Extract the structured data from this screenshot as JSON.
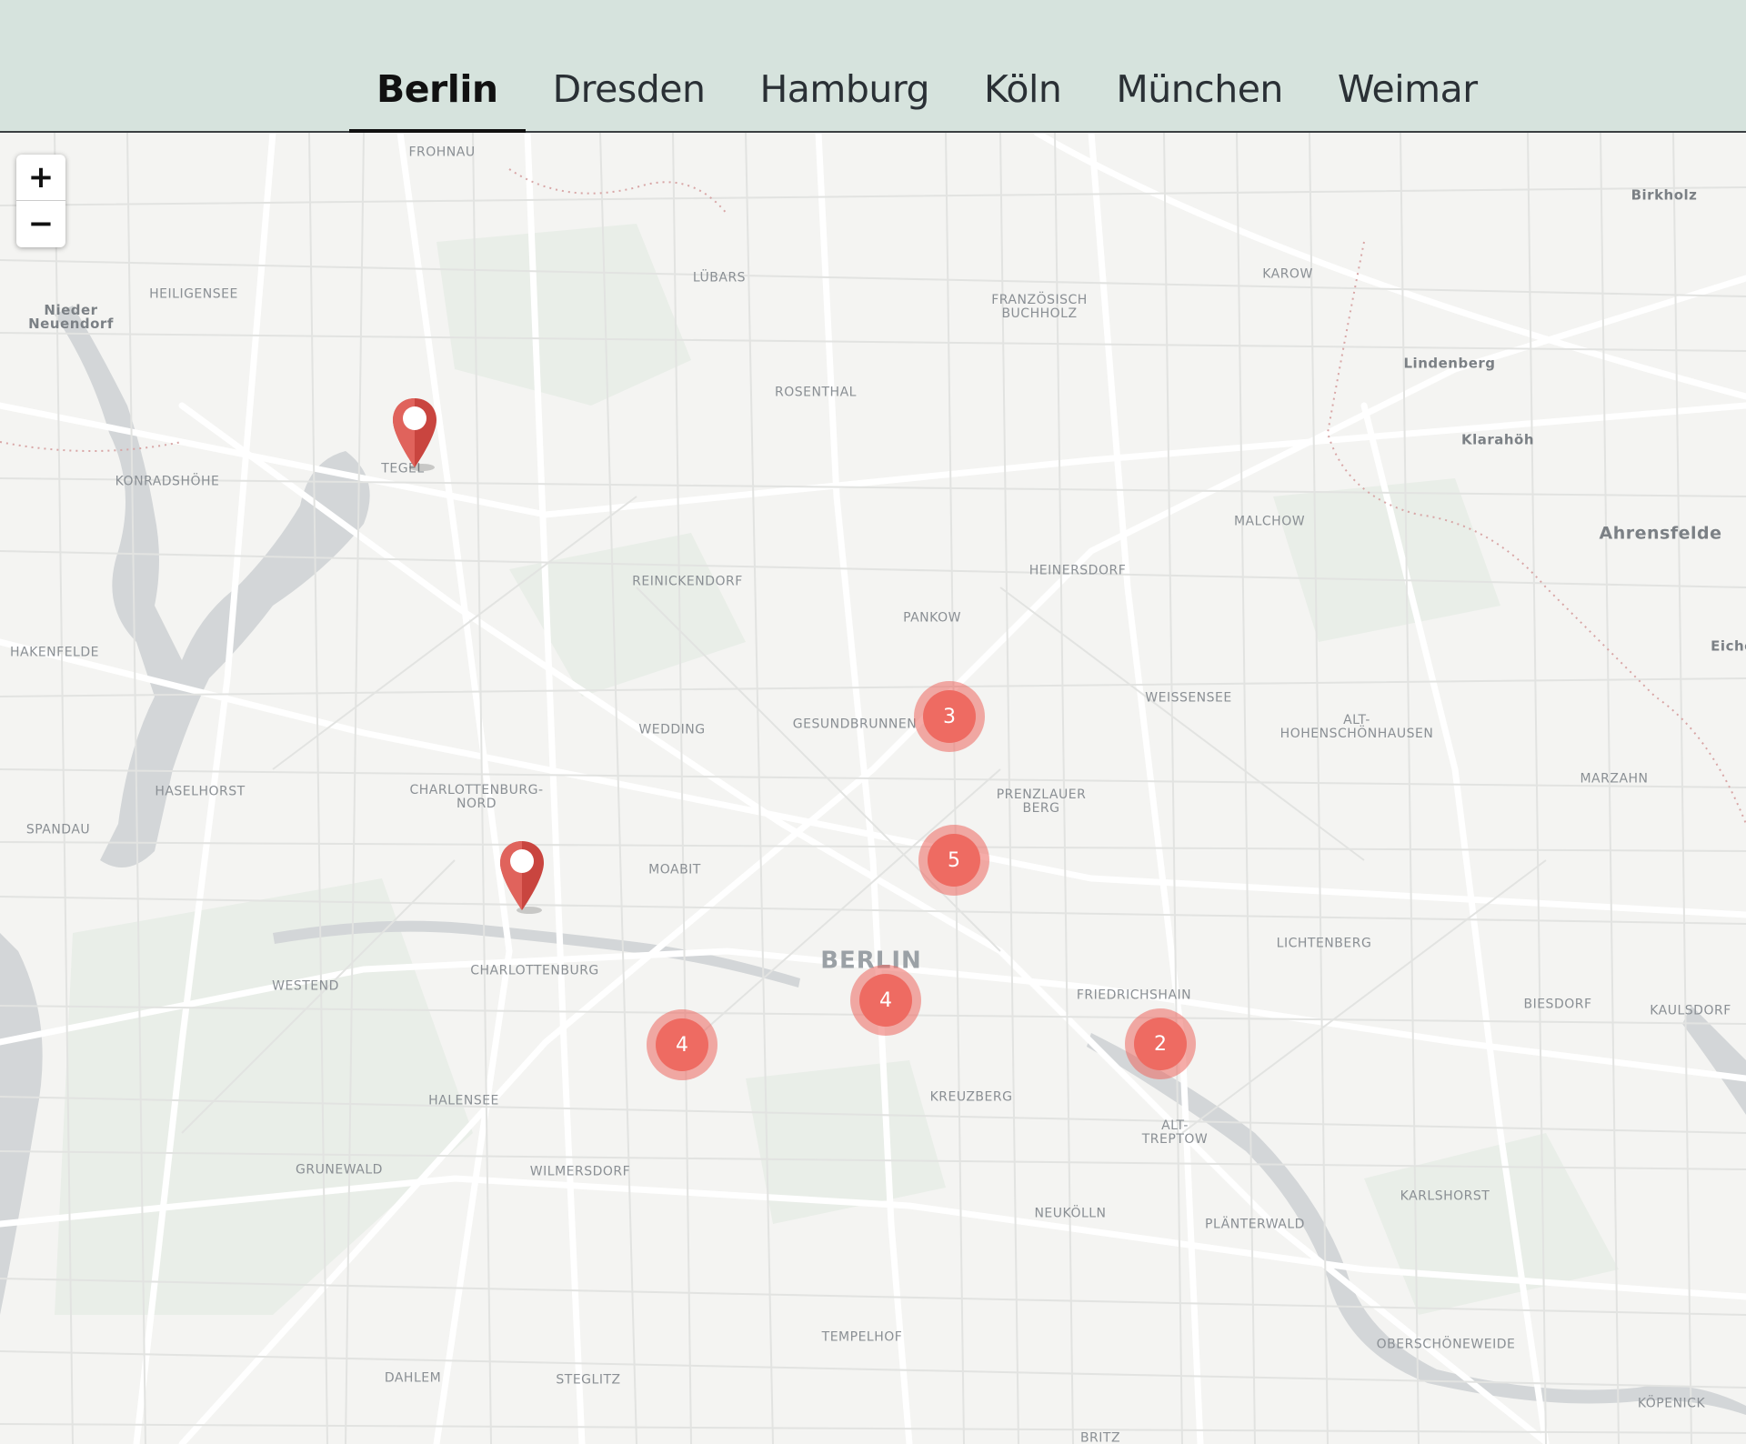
{
  "tabs": [
    {
      "label": "Berlin",
      "active": true
    },
    {
      "label": "Dresden",
      "active": false
    },
    {
      "label": "Hamburg",
      "active": false
    },
    {
      "label": "Köln",
      "active": false
    },
    {
      "label": "München",
      "active": false
    },
    {
      "label": "Weimar",
      "active": false
    }
  ],
  "map": {
    "zoom_in_label": "+",
    "zoom_out_label": "−",
    "marker_color": "#ee6b62",
    "clusters": [
      {
        "count": "3",
        "near": "Gesundbrunnen"
      },
      {
        "count": "5",
        "near": "Prenzlauer Berg"
      },
      {
        "count": "4",
        "near": "Berlin"
      },
      {
        "count": "4",
        "near": "Charlottenburg"
      },
      {
        "count": "2",
        "near": "Friedrichshain"
      }
    ],
    "pins": [
      {
        "near": "Tegel"
      },
      {
        "near": "Charlottenburg"
      }
    ],
    "places": [
      "Frohnau",
      "Birkholz",
      "Heiligensee",
      "Nieder\nNeuendorf",
      "Lübars",
      "Karow",
      "Französisch\nBuchholz",
      "Lindenberg",
      "Rosenthal",
      "Klarahöh",
      "Konradshöhe",
      "Tegel",
      "Malchow",
      "Ahrensfelde",
      "Heinersdorf",
      "Reinickendorf",
      "Pankow",
      "Hakenfelde",
      "Eiche",
      "Weissensee",
      "Wedding",
      "Gesundbrunnen",
      "Alt-\nHohenschönhausen",
      "Marzahn",
      "Haselhorst",
      "Charlottenburg-\nNord",
      "Prenzlauer\nBerg",
      "Spandau",
      "Moabit",
      "Lichtenberg",
      "Berlin",
      "Westend",
      "Charlottenburg",
      "Friedrichshain",
      "Biesdorf",
      "Kaulsdorf",
      "Halensee",
      "Kreuzberg",
      "Alt-\nTreptow",
      "Grunewald",
      "Wilmersdorf",
      "Karlshorst",
      "Neukölln",
      "Plänterwald",
      "Tempelhof",
      "Oberschöneweide",
      "Dahlem",
      "Steglitz",
      "Köpenick",
      "Britz"
    ]
  }
}
